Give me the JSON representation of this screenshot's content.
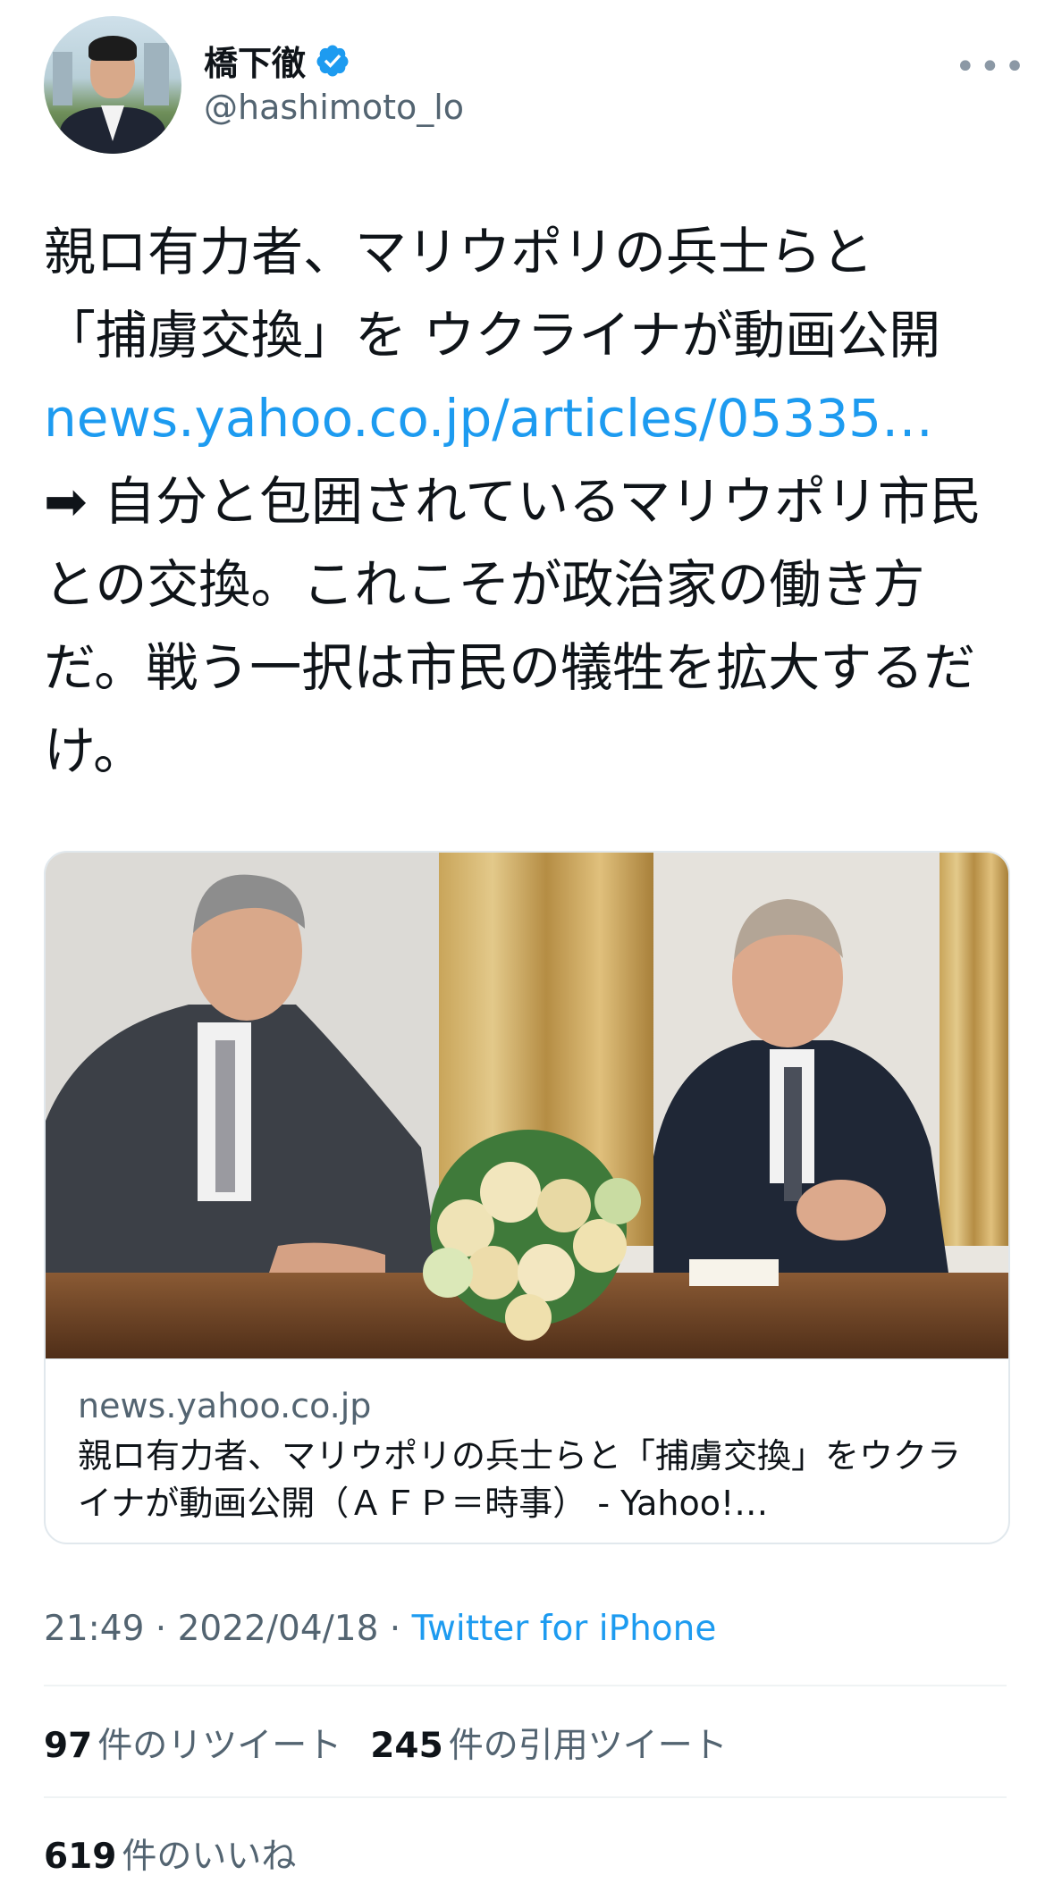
{
  "user": {
    "display_name": "橋下徹",
    "handle": "@hashimoto_lo",
    "verified": true,
    "more_icon": "more-horizontal-icon"
  },
  "tweet": {
    "line1": "親ロ有力者、マリウポリの兵士らと",
    "line2": "「捕虜交換」を ウクライナが動画公開",
    "link": "news.yahoo.co.jp/articles/05335…",
    "arrow": "➡",
    "comment": " 自分と包囲されているマリウポリ市民との交換。これこそが政治家の働き方だ。戦う一択は市民の犠牲を拡大するだけ。"
  },
  "card": {
    "domain": "news.yahoo.co.jp",
    "title": "親ロ有力者、マリウポリの兵士らと「捕虜交換」をウクライナが動画公開（ＡＦＰ＝時事） - Yahoo!…"
  },
  "meta": {
    "time": "21:49",
    "date": "2022/04/18",
    "separator": " · ",
    "source": "Twitter for iPhone"
  },
  "stats": {
    "retweets_count": "97",
    "retweets_label": "件のリツイート",
    "quotes_count": "245",
    "quotes_label": "件の引用ツイート",
    "likes_count": "619",
    "likes_label": "件のいいね"
  },
  "colors": {
    "link": "#1d9bf0",
    "secondary_text": "#536471",
    "primary_text": "#0f1419",
    "verified_badge": "#1d9bf0"
  }
}
